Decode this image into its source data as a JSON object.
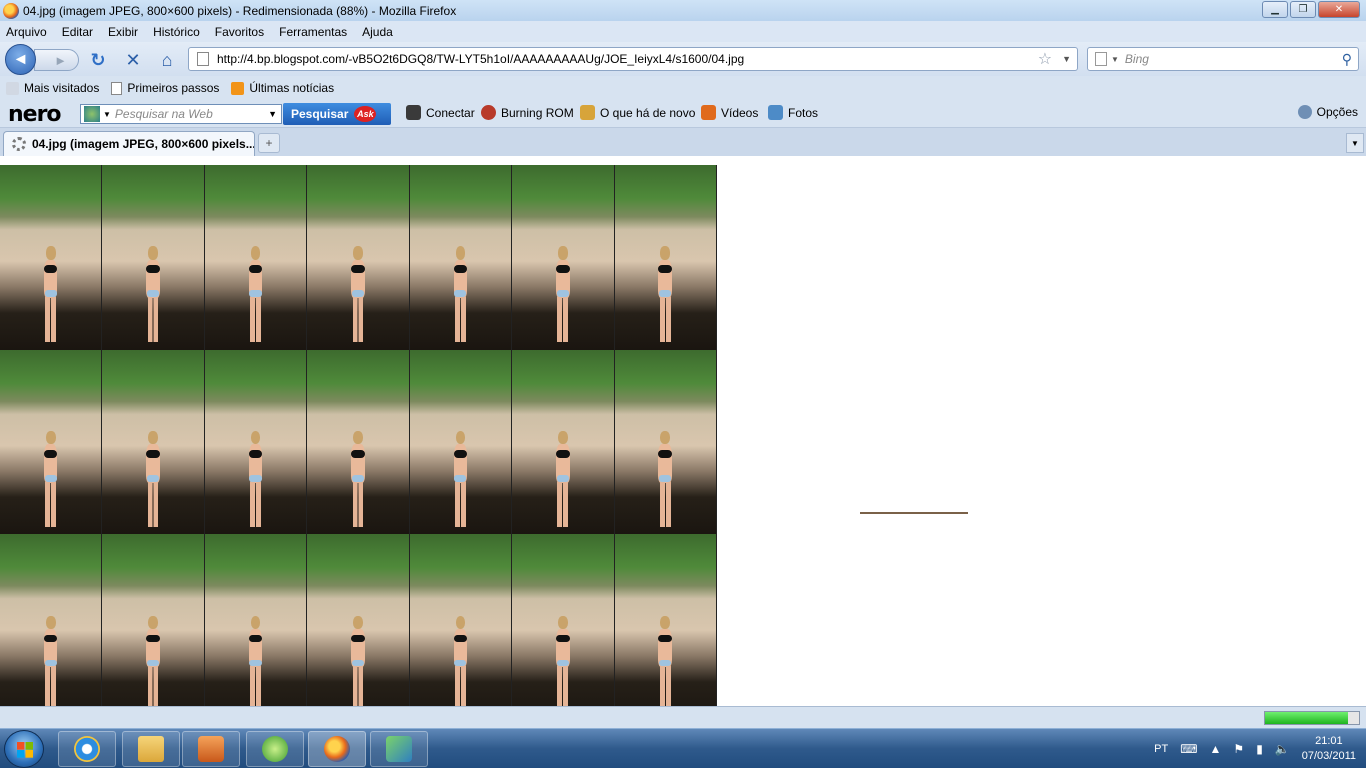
{
  "window": {
    "title": "04.jpg (imagem JPEG, 800×600 pixels) - Redimensionada (88%) - Mozilla Firefox",
    "min_glyph": "▁",
    "max_glyph": "❐",
    "close_glyph": "✕"
  },
  "menu": {
    "items": [
      "Arquivo",
      "Editar",
      "Exibir",
      "Histórico",
      "Favoritos",
      "Ferramentas",
      "Ajuda"
    ]
  },
  "nav": {
    "back_glyph": "◄",
    "forward_glyph": "►",
    "reload_glyph": "↻",
    "stop_glyph": "✕",
    "home_glyph": "⌂",
    "url": "http://4.bp.blogspot.com/-vB5O2t6DGQ8/TW-LYT5h1oI/AAAAAAAAAUg/JOE_IeiyxL4/s1600/04.jpg",
    "star_glyph": "☆",
    "drop_glyph": "▼",
    "search_placeholder": "Bing",
    "search_glyph": "⚲"
  },
  "bookmarks": {
    "items": [
      {
        "label": "Mais visitados",
        "icon": "star-icon"
      },
      {
        "label": "Primeiros passos",
        "icon": "page-icon"
      },
      {
        "label": "Últimas notícias",
        "icon": "rss-icon"
      }
    ]
  },
  "nero": {
    "logo": "nero",
    "search_placeholder": "Pesquisar na Web",
    "search_button": "Pesquisar",
    "ask_badge": "Ask",
    "items": {
      "connect": "Conectar",
      "burning": "Burning ROM",
      "whats_new": "O que há de novo",
      "videos": "Vídeos",
      "photos": "Fotos"
    },
    "options": "Opções",
    "colors": {
      "connect": "#3a3a3a",
      "burning": "#b83a2a",
      "whats_new": "#d7a43a",
      "videos": "#e06a1c",
      "photos": "#4d8bc7"
    }
  },
  "tabs": {
    "active_title": "04.jpg (imagem JPEG, 800×600 pixels...",
    "new_tab_glyph": "+",
    "list_glyph": "▼"
  },
  "content": {
    "tiles_rows": 3,
    "tiles_cols": 7
  },
  "status": {
    "progress_fraction": 0.88,
    "progress_color": "#22c022"
  },
  "taskbar": {
    "lang": "PT",
    "time": "21:01",
    "date": "07/03/2011",
    "apps": [
      "internet-explorer-icon",
      "folder-icon",
      "media-player-icon",
      "nero-app-icon",
      "firefox-icon",
      "network-app-icon"
    ]
  }
}
